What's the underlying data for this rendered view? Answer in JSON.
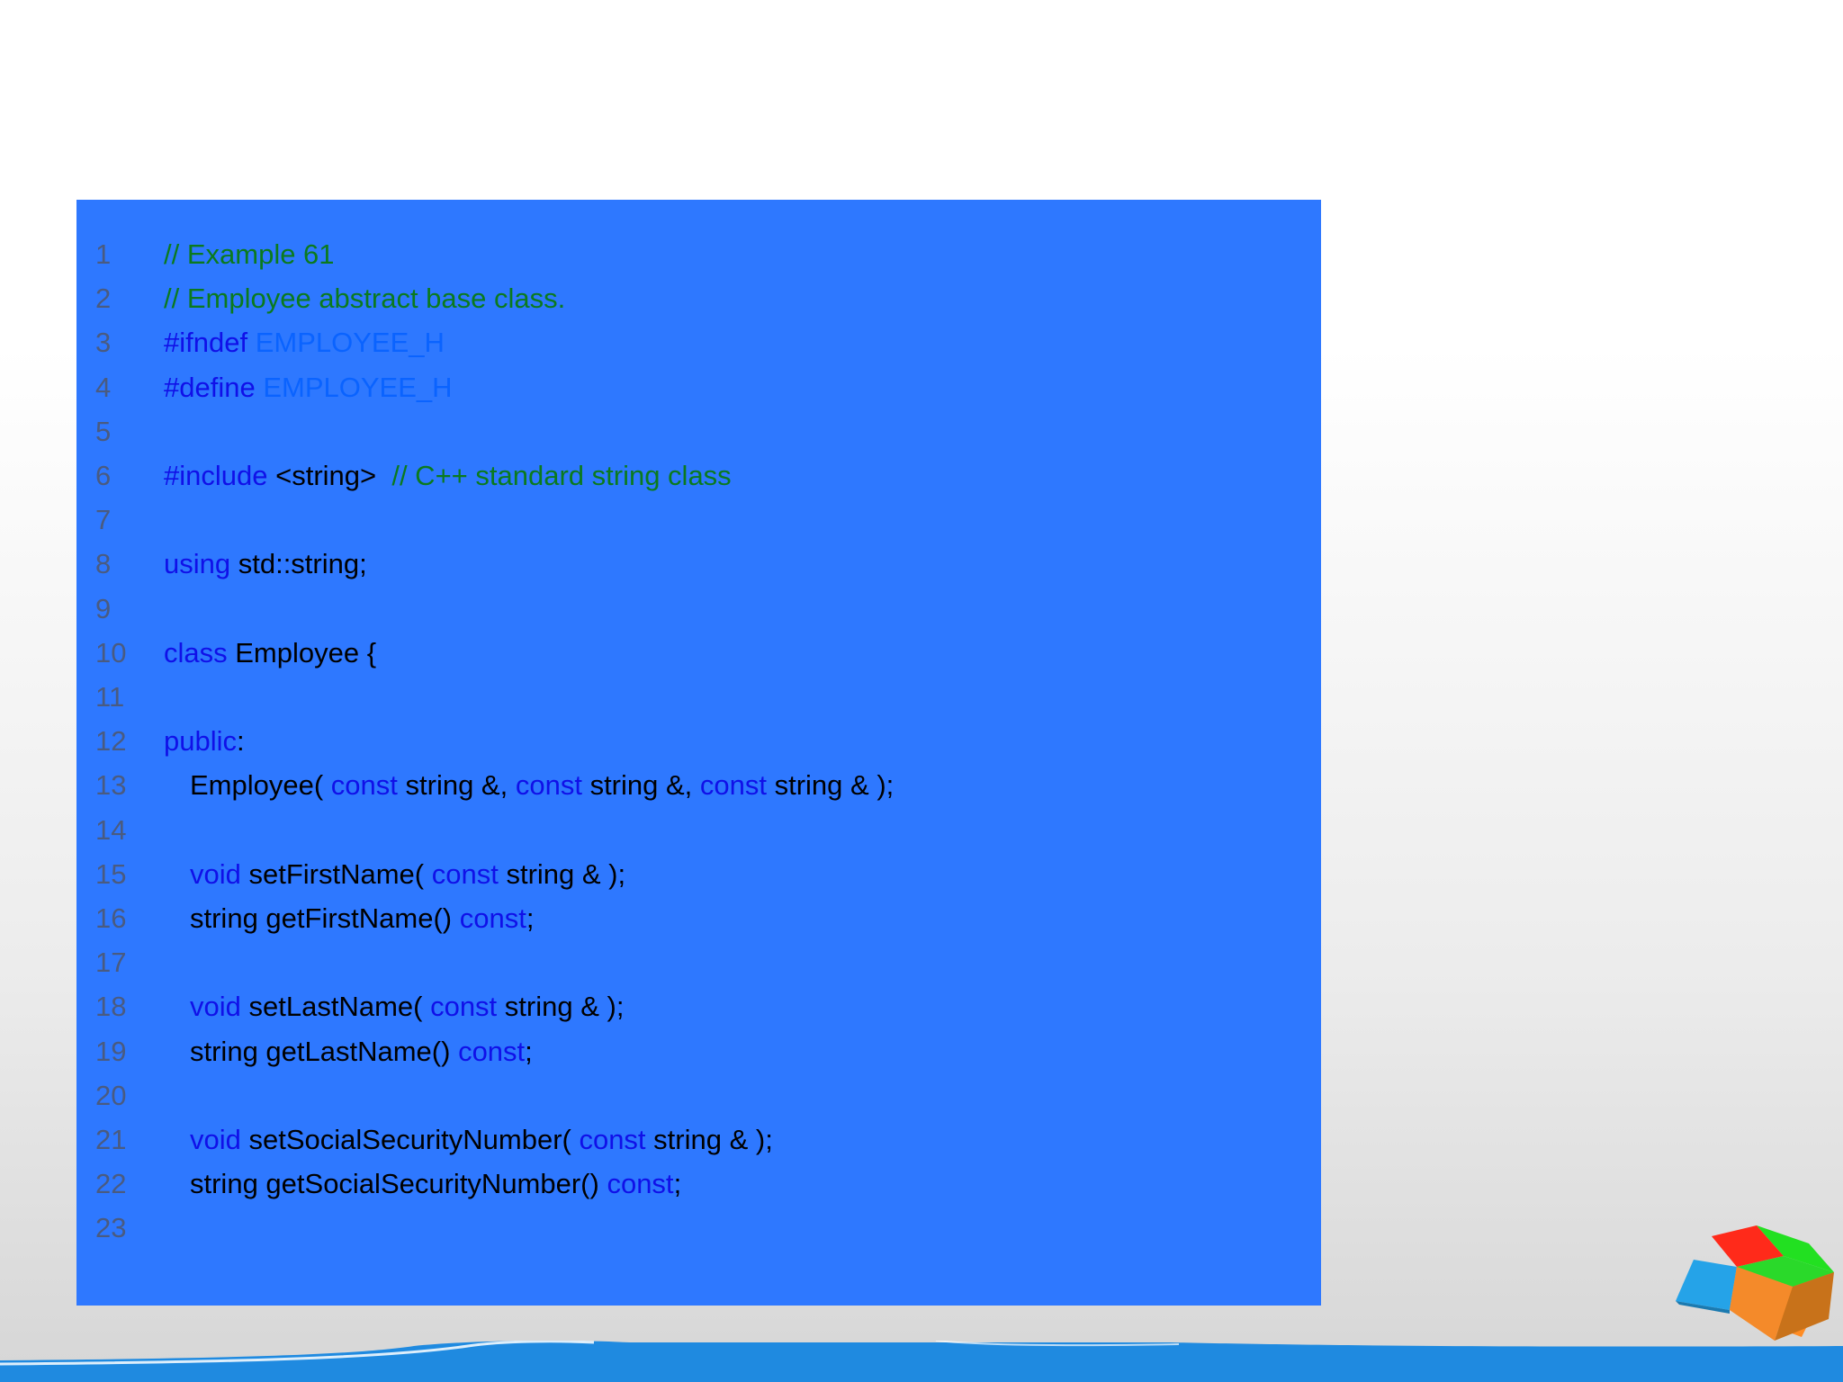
{
  "code_lines": [
    {
      "num": "1",
      "indent": false,
      "tokens": [
        {
          "t": "comment",
          "v": "// Example 61"
        }
      ]
    },
    {
      "num": "2",
      "indent": false,
      "tokens": [
        {
          "t": "comment",
          "v": "// Employee abstract base class."
        }
      ]
    },
    {
      "num": "3",
      "indent": false,
      "tokens": [
        {
          "t": "kw",
          "v": "#ifndef"
        },
        {
          "t": "text",
          "v": " "
        },
        {
          "t": "macro",
          "v": "EMPLOYEE_H"
        }
      ]
    },
    {
      "num": "4",
      "indent": false,
      "tokens": [
        {
          "t": "kw",
          "v": "#define"
        },
        {
          "t": "text",
          "v": " "
        },
        {
          "t": "macro",
          "v": "EMPLOYEE_H"
        }
      ]
    },
    {
      "num": "5",
      "indent": false,
      "tokens": []
    },
    {
      "num": "6",
      "indent": false,
      "tokens": [
        {
          "t": "kw",
          "v": "#include"
        },
        {
          "t": "text",
          "v": " <string>  "
        },
        {
          "t": "comment",
          "v": "// C++ standard string class"
        }
      ]
    },
    {
      "num": "7",
      "indent": false,
      "tokens": []
    },
    {
      "num": "8",
      "indent": false,
      "tokens": [
        {
          "t": "kw",
          "v": "using"
        },
        {
          "t": "text",
          "v": " std::string;"
        }
      ]
    },
    {
      "num": "9",
      "indent": false,
      "tokens": []
    },
    {
      "num": "10",
      "indent": false,
      "tokens": [
        {
          "t": "kw",
          "v": "class"
        },
        {
          "t": "text",
          "v": " Employee {"
        }
      ]
    },
    {
      "num": "11",
      "indent": false,
      "tokens": []
    },
    {
      "num": "12",
      "indent": false,
      "tokens": [
        {
          "t": "kw",
          "v": "public"
        },
        {
          "t": "text",
          "v": ":"
        }
      ]
    },
    {
      "num": "13",
      "indent": true,
      "tokens": [
        {
          "t": "text",
          "v": "Employee( "
        },
        {
          "t": "kw",
          "v": "const"
        },
        {
          "t": "text",
          "v": " string &, "
        },
        {
          "t": "kw",
          "v": "const"
        },
        {
          "t": "text",
          "v": " string &, "
        },
        {
          "t": "kw",
          "v": "const"
        },
        {
          "t": "text",
          "v": " string & );"
        }
      ]
    },
    {
      "num": "14",
      "indent": false,
      "tokens": []
    },
    {
      "num": "15",
      "indent": true,
      "tokens": [
        {
          "t": "kw",
          "v": "void"
        },
        {
          "t": "text",
          "v": " setFirstName( "
        },
        {
          "t": "kw",
          "v": "const"
        },
        {
          "t": "text",
          "v": " string & );"
        }
      ]
    },
    {
      "num": "16",
      "indent": true,
      "tokens": [
        {
          "t": "text",
          "v": "string getFirstName() "
        },
        {
          "t": "kw",
          "v": "const"
        },
        {
          "t": "text",
          "v": ";"
        }
      ]
    },
    {
      "num": "17",
      "indent": false,
      "tokens": []
    },
    {
      "num": "18",
      "indent": true,
      "tokens": [
        {
          "t": "kw",
          "v": "void"
        },
        {
          "t": "text",
          "v": " setLastName( "
        },
        {
          "t": "kw",
          "v": "const"
        },
        {
          "t": "text",
          "v": " string & );"
        }
      ]
    },
    {
      "num": "19",
      "indent": true,
      "tokens": [
        {
          "t": "text",
          "v": "string getLastName() "
        },
        {
          "t": "kw",
          "v": "const"
        },
        {
          "t": "text",
          "v": ";"
        }
      ]
    },
    {
      "num": "20",
      "indent": false,
      "tokens": []
    },
    {
      "num": "21",
      "indent": true,
      "tokens": [
        {
          "t": "kw",
          "v": "void"
        },
        {
          "t": "text",
          "v": " setSocialSecurityNumber( "
        },
        {
          "t": "kw",
          "v": "const"
        },
        {
          "t": "text",
          "v": " string & );"
        }
      ]
    },
    {
      "num": "22",
      "indent": true,
      "tokens": [
        {
          "t": "text",
          "v": "string getSocialSecurityNumber() "
        },
        {
          "t": "kw",
          "v": "const"
        },
        {
          "t": "text",
          "v": ";"
        }
      ]
    },
    {
      "num": "23",
      "indent": false,
      "tokens": []
    }
  ],
  "colors": {
    "panel_background": "#2e78ff",
    "line_number": "#4a5b80",
    "comment": "#0b7a1e",
    "keyword": "#1010e8",
    "macro": "#0a63ff",
    "text": "#000000",
    "footer_band": "#1e88e5"
  },
  "decorations": {
    "logo_icon": "four-color-cube-icon",
    "footer": "blue-wave-band"
  }
}
